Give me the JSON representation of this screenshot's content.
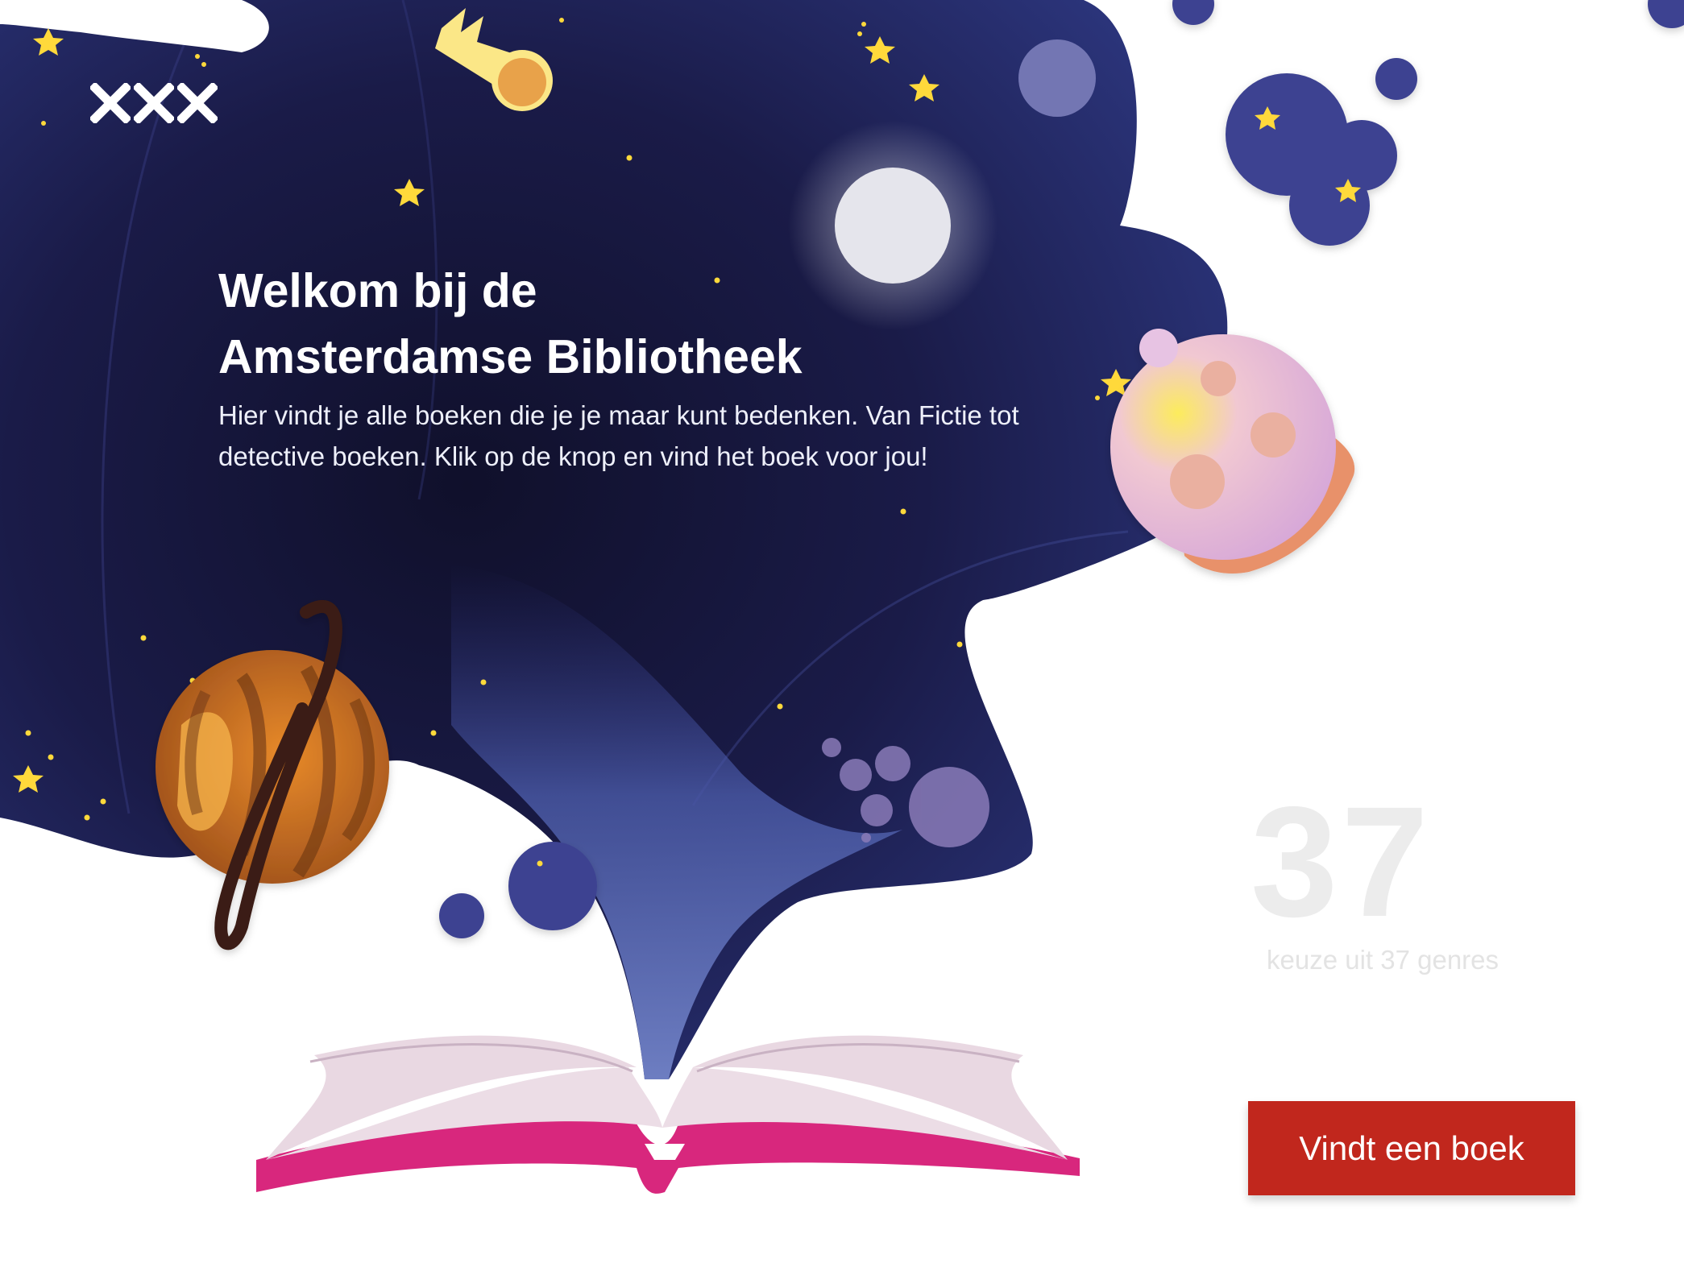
{
  "hero": {
    "title_line1": "Welkom bij de",
    "title_line2": "Amsterdamse Bibliotheek",
    "intro": "Hier vindt je alle boeken die je je maar kunt bedenken. Van Fictie tot detective boeken. Klik op de knop en vind het boek voor jou!"
  },
  "genres": {
    "count": "37",
    "caption": "keuze uit 37 genres"
  },
  "cta": {
    "label": "Vindt een boek"
  },
  "icons": {
    "logo": "amsterdam-xxx-logo",
    "planets": [
      "ringed-planet",
      "pink-planet",
      "moon",
      "comet"
    ],
    "decor": "open-book"
  },
  "colors": {
    "space": "#1f2157",
    "space_dark": "#11112e",
    "accent_red": "#c1271d",
    "book_pink": "#d8277d",
    "star_yellow": "#ffd93b",
    "bubble_blue": "#3d4391"
  }
}
